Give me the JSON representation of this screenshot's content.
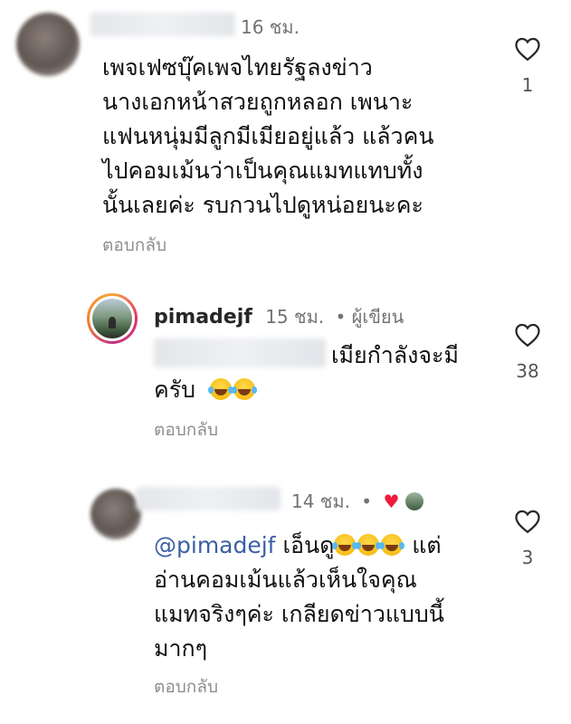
{
  "comments": [
    {
      "time": "16 ชม.",
      "lines": [
        "เพจเฟซบุ๊คเพจไทยรัฐลงข่าว",
        "นางเอกหน้าสวยถูกหลอก เพนาะ",
        "แฟนหนุ่มมีลูกมีเมียอยู่แล้ว แล้วคน",
        "ไปคอมเม้นว่าเป็นคุณแมทแทบทั้ง",
        "นั้นเลยค่ะ รบกวนไปดูหน่อยนะคะ"
      ],
      "reply_label": "ตอบกลับ",
      "like_count": "1"
    },
    {
      "username": "pimadejf",
      "time": "15 ชม.",
      "author_tag": "• ผู้เขียน",
      "line1": "เมียกำลังจะมี",
      "line2": "ครับ",
      "reply_label": "ตอบกลับ",
      "like_count": "38"
    },
    {
      "time": "14 ชม.",
      "mention": "@pimadejf",
      "line1_text": "เอ็นดู",
      "line1_end": "แต่",
      "lines": [
        "อ่านคอมเม้นแล้วเห็นใจคุณ",
        "แมทจริงๆค่ะ เกลียดข่าวแบบนี้",
        "มากๆ"
      ],
      "reply_label": "ตอบกลับ",
      "like_count": "3"
    }
  ],
  "icons": {
    "like": "heart-outline-icon",
    "author_like": "red-heart-icon",
    "emoji": "grinning-sweat-emoji"
  },
  "colors": {
    "mention": "#3b5fa6",
    "meta": "#737373",
    "heart": "#ed1c3a"
  }
}
